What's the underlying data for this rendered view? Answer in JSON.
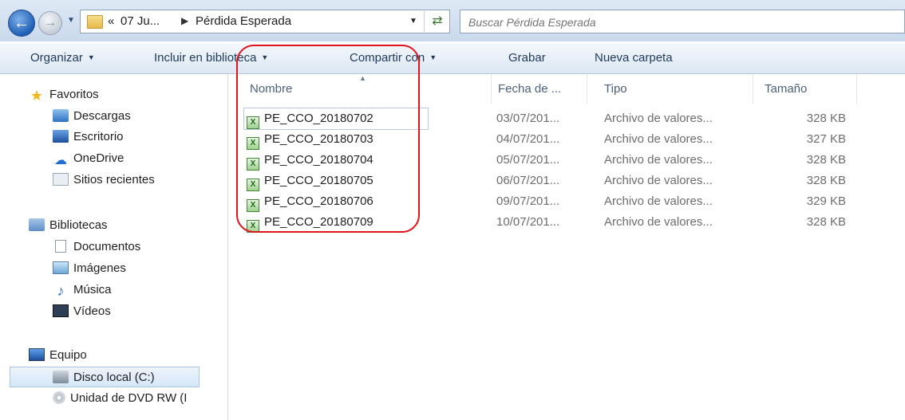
{
  "address_bar": {
    "overflow": "«",
    "crumbs": [
      "07 Ju...",
      "Pérdida Esperada"
    ],
    "separator": "▶"
  },
  "search": {
    "placeholder": "Buscar Pérdida Esperada"
  },
  "toolbar": {
    "organize": "Organizar",
    "include_library": "Incluir en biblioteca",
    "share": "Compartir con",
    "burn": "Grabar",
    "new_folder": "Nueva carpeta"
  },
  "nav": {
    "favorites": "Favoritos",
    "downloads": "Descargas",
    "desktop": "Escritorio",
    "onedrive": "OneDrive",
    "recent": "Sitios recientes",
    "libraries": "Bibliotecas",
    "documents": "Documentos",
    "images": "Imágenes",
    "music": "Música",
    "videos": "Vídeos",
    "computer": "Equipo",
    "local_disk": "Disco local (C:)",
    "dvd": "Unidad de DVD RW (I"
  },
  "columns": {
    "name": "Nombre",
    "date": "Fecha de ...",
    "type": "Tipo",
    "size": "Tamaño"
  },
  "files": [
    {
      "name": "PE_CCO_20180702",
      "date": "03/07/201...",
      "type": "Archivo de valores...",
      "size": "328 KB"
    },
    {
      "name": "PE_CCO_20180703",
      "date": "04/07/201...",
      "type": "Archivo de valores...",
      "size": "327 KB"
    },
    {
      "name": "PE_CCO_20180704",
      "date": "05/07/201...",
      "type": "Archivo de valores...",
      "size": "328 KB"
    },
    {
      "name": "PE_CCO_20180705",
      "date": "06/07/201...",
      "type": "Archivo de valores...",
      "size": "328 KB"
    },
    {
      "name": "PE_CCO_20180706",
      "date": "09/07/201...",
      "type": "Archivo de valores...",
      "size": "329 KB"
    },
    {
      "name": "PE_CCO_20180709",
      "date": "10/07/201...",
      "type": "Archivo de valores...",
      "size": "328 KB"
    }
  ],
  "colors": {
    "annotation": "#e0141b",
    "toolbar_text": "#1e395b",
    "column_header": "#4c607a"
  }
}
